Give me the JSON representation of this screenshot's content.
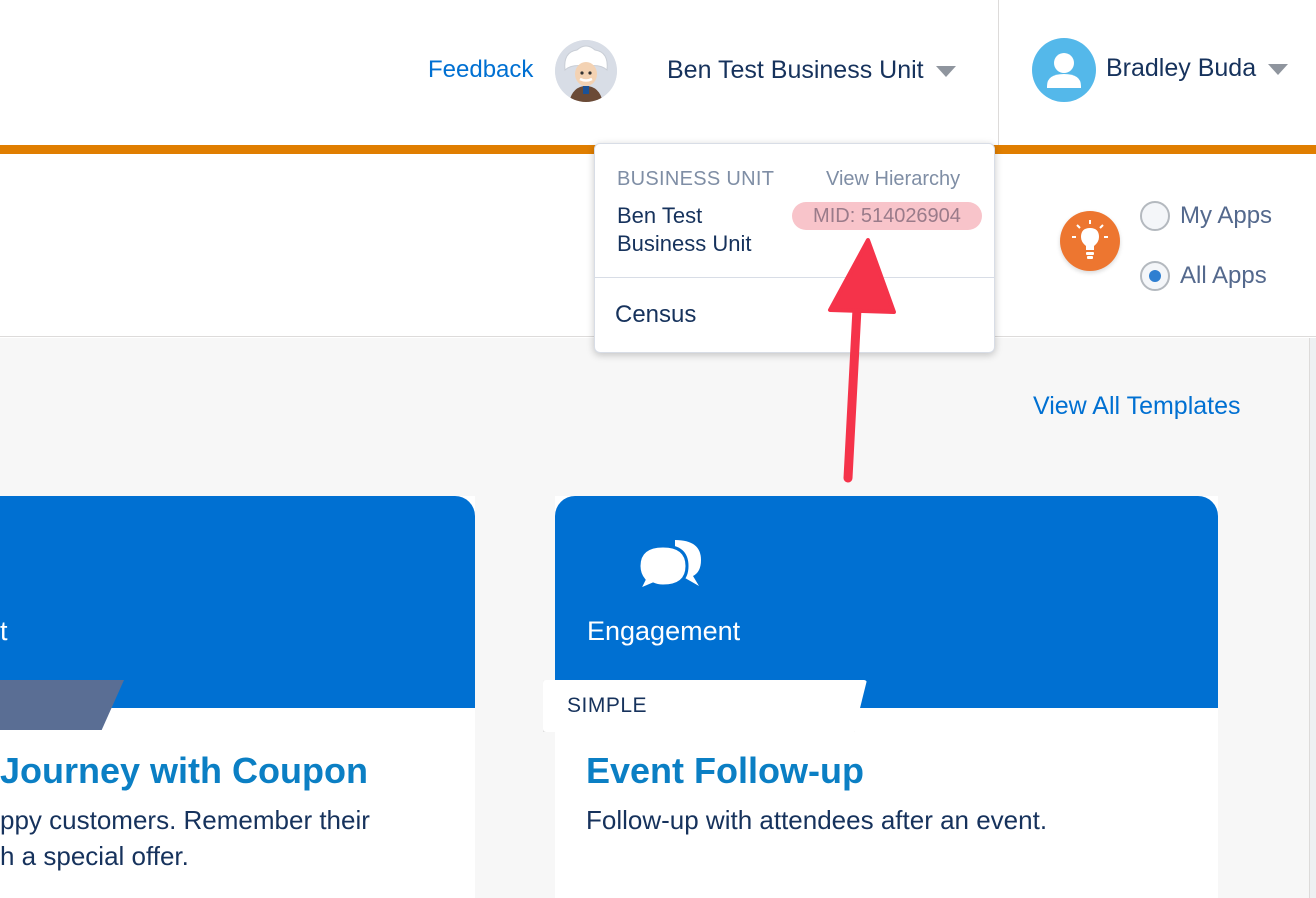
{
  "header": {
    "feedback_label": "Feedback",
    "business_unit_label": "Ben Test Business Unit",
    "user_name": "Bradley Buda"
  },
  "app_switcher": {
    "options": [
      {
        "label": "My Apps",
        "checked": false
      },
      {
        "label": "All Apps",
        "checked": true
      }
    ]
  },
  "dropdown": {
    "section_label": "BUSINESS UNIT",
    "view_hierarchy_label": "View Hierarchy",
    "current_unit": "Ben Test Business Unit",
    "mid_label": "MID: 514026904",
    "other_units": [
      "Census"
    ]
  },
  "content": {
    "view_all_label": "View All Templates",
    "cards": [
      {
        "category": "t",
        "title": "Journey with Coupon",
        "description_line1": "ppy customers. Remember their",
        "description_line2": "h a special offer."
      },
      {
        "category": "Engagement",
        "ribbon": "SIMPLE",
        "title": "Event Follow-up",
        "description_line1": "Follow-up with attendees after an event."
      }
    ]
  },
  "colors": {
    "accent_blue": "#0070d2",
    "orange_bar": "#e07e00",
    "annotation_arrow": "#f5334a",
    "mid_highlight": "#f8c4ca"
  },
  "icons": [
    "einstein-avatar",
    "user-avatar-icon",
    "lightbulb-icon",
    "chat-bubbles-icon",
    "caret-down-icon"
  ]
}
